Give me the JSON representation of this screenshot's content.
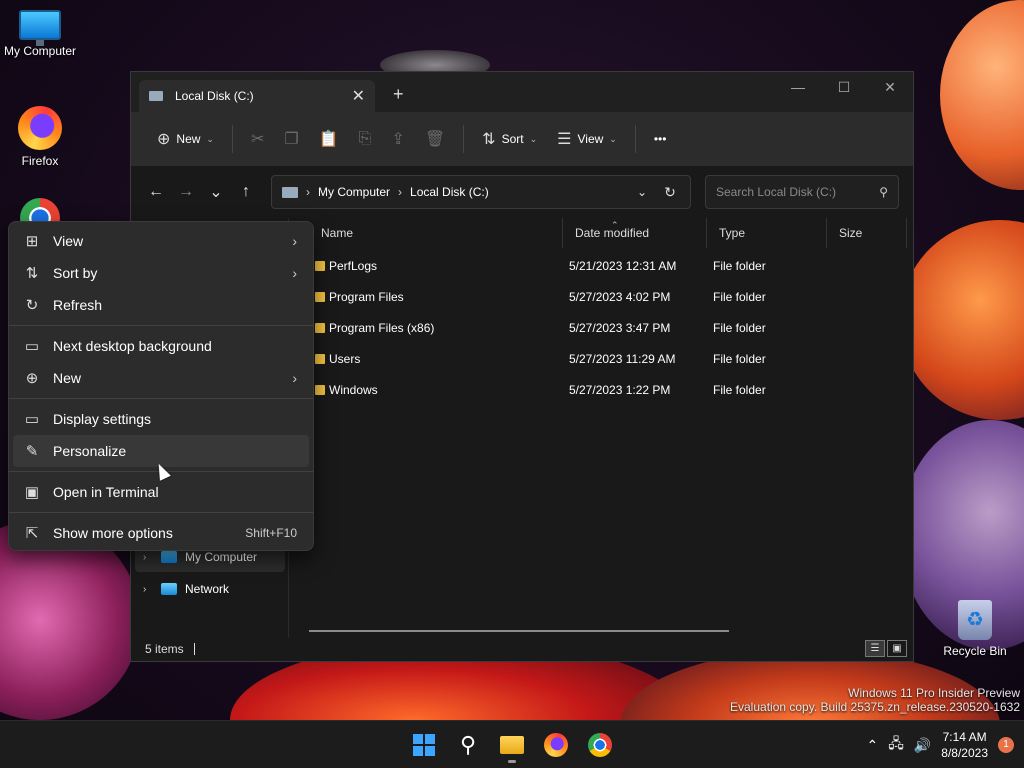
{
  "desktop": {
    "icons": [
      {
        "label": "My Computer"
      },
      {
        "label": "Firefox"
      },
      {
        "label": "Recycle Bin"
      }
    ]
  },
  "explorer": {
    "tab_title": "Local Disk (C:)",
    "new_tab": "+",
    "window_controls": {
      "minimize": "—",
      "maximize": "☐",
      "close": "✕"
    },
    "commandbar": {
      "new_label": "New",
      "sort_label": "Sort",
      "view_label": "View",
      "more_label": "•••"
    },
    "address": {
      "crumbs": [
        "My Computer",
        "Local Disk (C:)"
      ],
      "search_placeholder": "Search Local Disk (C:)"
    },
    "columns": {
      "name": "Name",
      "date": "Date modified",
      "type": "Type",
      "size": "Size"
    },
    "files": [
      {
        "name": "PerfLogs",
        "date": "5/21/2023 12:31 AM",
        "type": "File folder"
      },
      {
        "name": "Program Files",
        "date": "5/27/2023 4:02 PM",
        "type": "File folder"
      },
      {
        "name": "Program Files (x86)",
        "date": "5/27/2023 3:47 PM",
        "type": "File folder"
      },
      {
        "name": "Users",
        "date": "5/27/2023 11:29 AM",
        "type": "File folder"
      },
      {
        "name": "Windows",
        "date": "5/27/2023 1:22 PM",
        "type": "File folder"
      }
    ],
    "navpane": [
      {
        "label": "My Computer"
      },
      {
        "label": "Network"
      }
    ],
    "status": "5 items"
  },
  "context_menu": {
    "items": {
      "view": "View",
      "sort_by": "Sort by",
      "refresh": "Refresh",
      "next_bg": "Next desktop background",
      "new": "New",
      "display": "Display settings",
      "personalize": "Personalize",
      "terminal": "Open in Terminal",
      "more": "Show more options",
      "more_shortcut": "Shift+F10"
    }
  },
  "watermark": {
    "line1": "Windows 11 Pro Insider Preview",
    "line2": "Evaluation copy. Build 25375.zn_release.230520-1632"
  },
  "taskbar": {
    "time": "7:14 AM",
    "date": "8/8/2023",
    "notification_count": "1"
  },
  "colors": {
    "accent": "#3aa6ff",
    "folder": "#f4c542",
    "menu_bg": "#2c2c2c",
    "window_bg": "#191919"
  }
}
